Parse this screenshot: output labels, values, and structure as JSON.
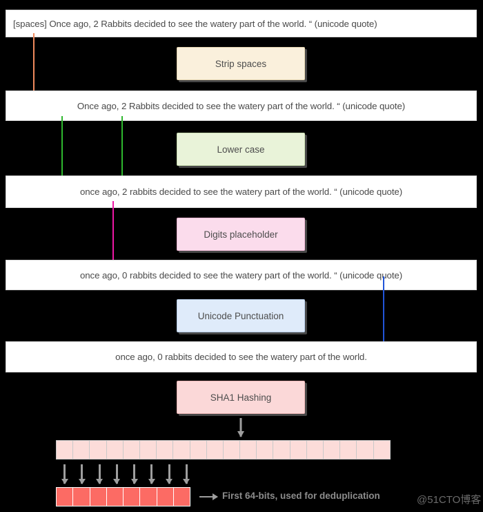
{
  "diagram": {
    "title": "Text normalization and SHA1 hashing pipeline",
    "background_color": "#000000"
  },
  "rows": [
    {
      "id": "row-original",
      "text": "[spaces] Once ago, 2 Rabbits decided to see the watery part of the world. “ (unicode quote)"
    },
    {
      "id": "row-stripped",
      "text": "Once ago, 2 Rabbits decided to see the watery part of the world. “ (unicode quote)"
    },
    {
      "id": "row-lowercased",
      "text": "once ago, 2 rabbits decided to see the watery part of the world. “ (unicode quote)"
    },
    {
      "id": "row-digits-replaced",
      "text": "once ago, 0 rabbits decided to see the watery part of the world. “ (unicode quote)"
    },
    {
      "id": "row-punctuation-normalized",
      "text": "once ago, 0 rabbits decided to see the watery part of the world."
    }
  ],
  "steps": [
    {
      "id": "step-strip-spaces",
      "label": "Strip spaces",
      "fill": "#faf0dc",
      "border": "#e2d2ae"
    },
    {
      "id": "step-lower-case",
      "label": "Lower case",
      "fill": "#e9f3d9",
      "border": "#c9ddb0"
    },
    {
      "id": "step-digits-placeholder",
      "label": "Digits placeholder",
      "fill": "#fbdcec",
      "border": "#edb8d4"
    },
    {
      "id": "step-unicode-punctuation",
      "label": "Unicode Punctuation",
      "fill": "#dfebfa",
      "border": "#b7cde8"
    },
    {
      "id": "step-sha1-hashing",
      "label": "SHA1 Hashing",
      "fill": "#fbd8d8",
      "border": "#ebb5b5"
    }
  ],
  "annotations": {
    "arrow_spaces_color": "#f08a5d",
    "arrow_case_color": "#2eb82e",
    "arrow_digits_color": "#ef17a6",
    "arrow_quote_color": "#2154d8",
    "arrow_gray_color": "#9e9e9e"
  },
  "hash": {
    "full_cells": 20,
    "prefix_cells": 8,
    "full_color": "#fcdcd9",
    "prefix_color": "#fc6b64",
    "caption": "First 64-bits, used for deduplication"
  },
  "watermark": {
    "text": "@51CTO博客"
  }
}
